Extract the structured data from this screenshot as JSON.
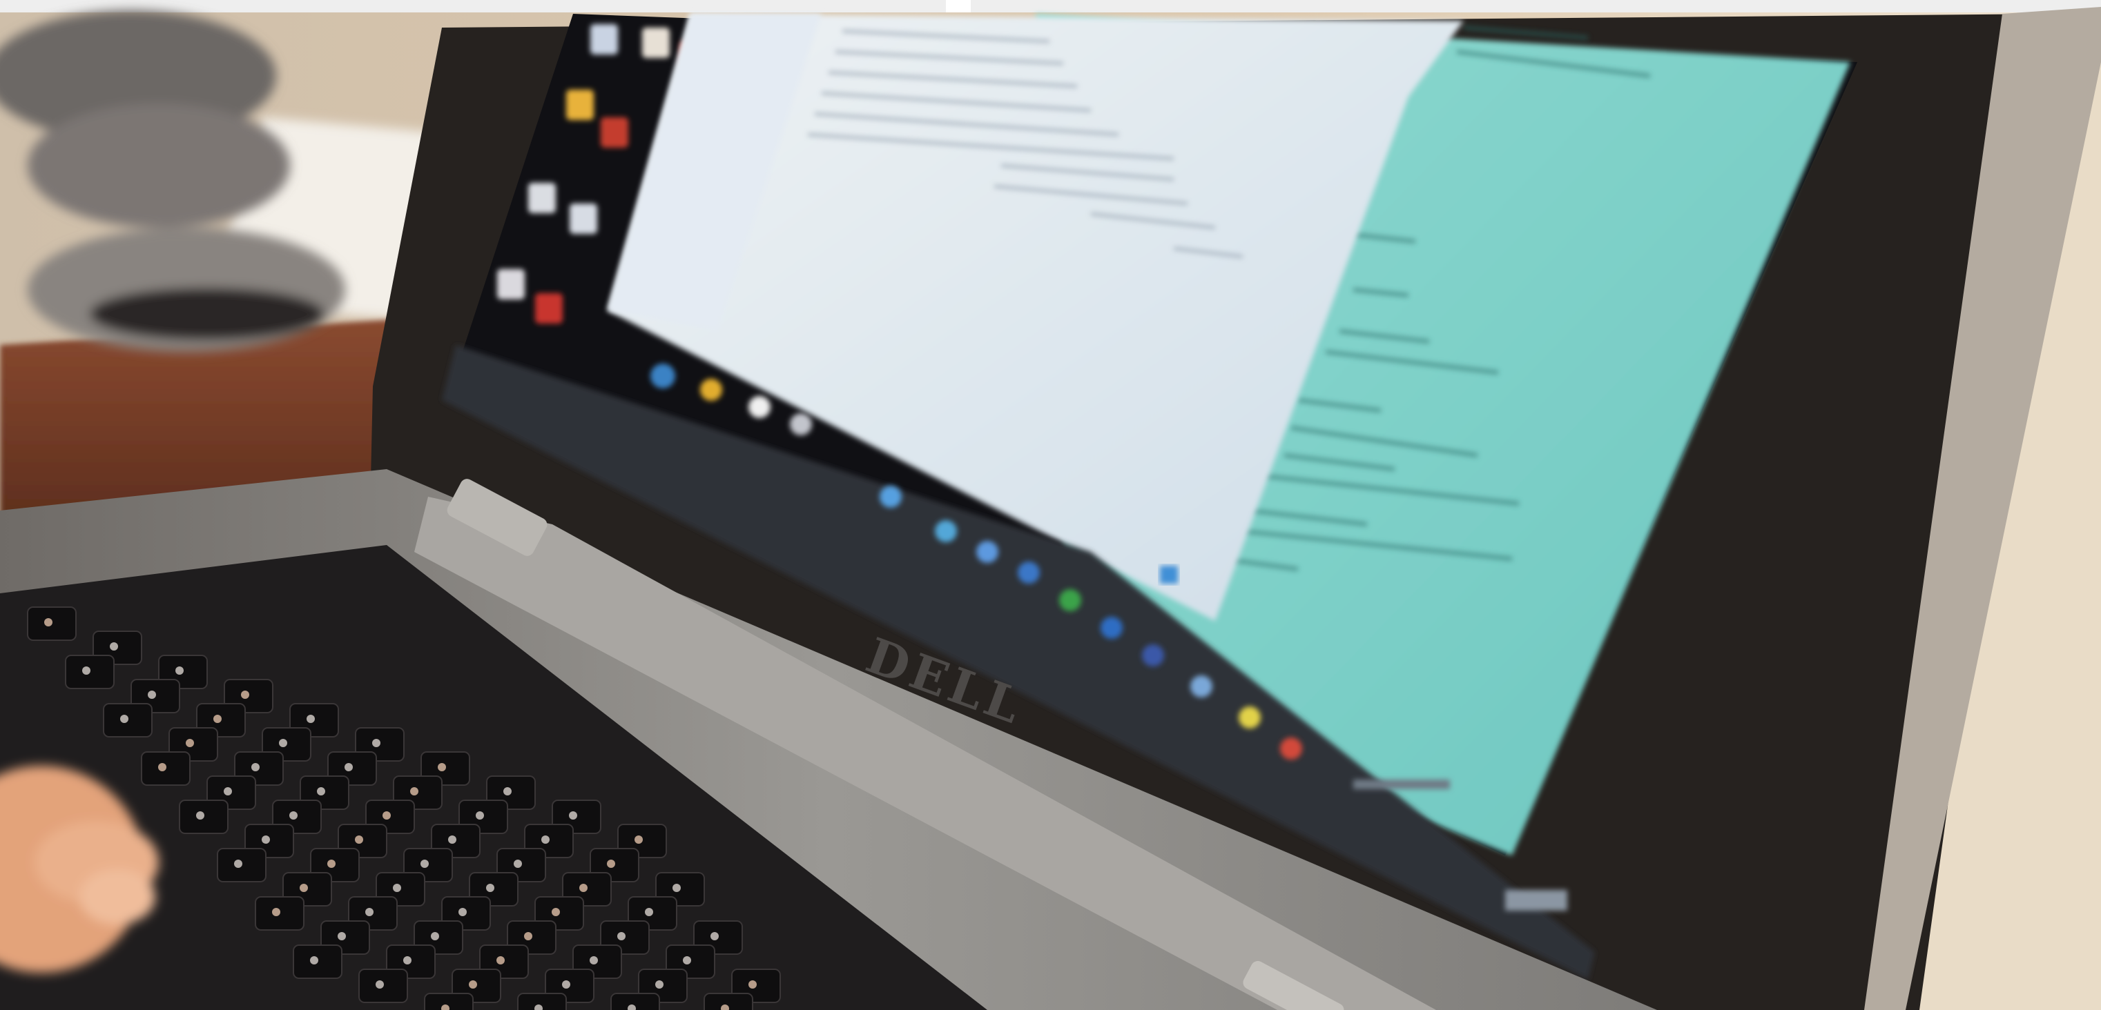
{
  "scene": {
    "description_visible_text": "",
    "logo": {
      "text": "DELL"
    },
    "colors": {
      "wall": "#d8c2a7",
      "wall_light": "#efe2cd",
      "desk": "#7a3f28",
      "laptop_body": "#8e8e8e",
      "laptop_bezel": "#1e1c1d",
      "screen_teal": "#7fcfc7",
      "window_white": "#dfe8ef",
      "taskbar": "#2b2f38",
      "keyboard": "#232122",
      "glove": "#7f7a77",
      "hand": "#e2a27a"
    }
  }
}
